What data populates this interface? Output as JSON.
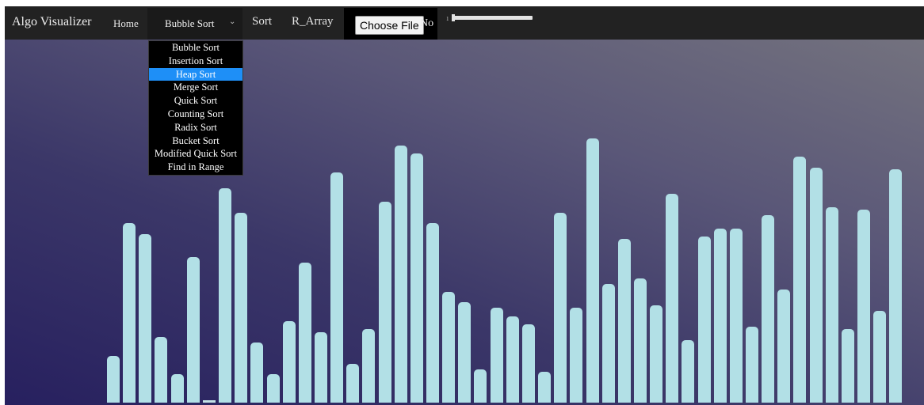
{
  "navbar": {
    "brand": "Algo Visualizer",
    "home": "Home",
    "algorithm_select": {
      "selected": "Bubble Sort",
      "chevron_icon": "chevron-down-icon"
    },
    "sort": "Sort",
    "r_array": "R_Array",
    "file_input": {
      "button": "Choose File",
      "status": "No"
    },
    "size_slider": {
      "value_label": "1"
    }
  },
  "dropdown": {
    "options": [
      "Bubble Sort",
      "Insertion Sort",
      "Heap Sort",
      "Merge Sort",
      "Quick Sort",
      "Counting Sort",
      "Radix Sort",
      "Bucket Sort",
      "Modified Quick Sort",
      "Find in Range"
    ],
    "highlighted": "Heap Sort"
  },
  "array": {
    "bar_color": "#b2e0e6",
    "values": [
      59,
      227,
      213,
      83,
      36,
      184,
      0,
      271,
      240,
      76,
      36,
      103,
      177,
      89,
      291,
      49,
      93,
      254,
      325,
      315,
      227,
      140,
      127,
      42,
      120,
      109,
      99,
      39,
      240,
      120,
      334,
      150,
      207,
      157,
      123,
      264,
      79,
      210,
      220,
      220,
      96,
      237,
      143,
      311,
      297,
      247,
      93,
      244,
      116,
      295
    ]
  }
}
